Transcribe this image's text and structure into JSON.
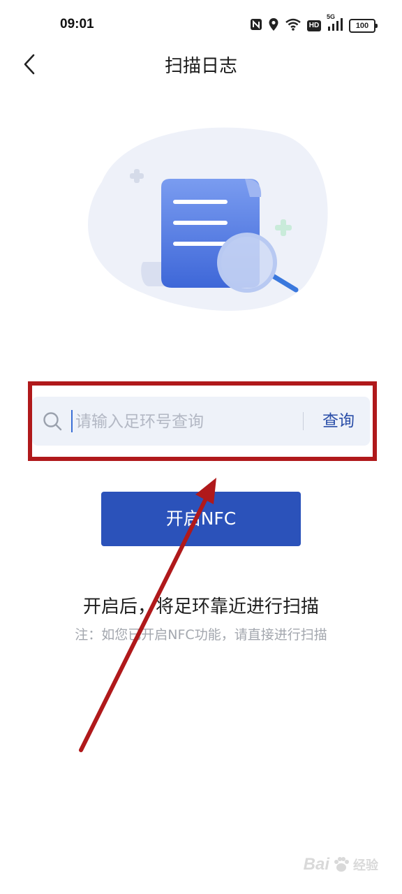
{
  "status_bar": {
    "time": "09:01",
    "battery": "100",
    "hd": "HD",
    "network": "5G",
    "icons": [
      "nfc-icon",
      "location-icon",
      "wifi-icon",
      "hd-icon",
      "signal-icon",
      "battery-icon"
    ]
  },
  "header": {
    "title": "扫描日志",
    "back_icon": "chevron-left-icon"
  },
  "search": {
    "placeholder": "请输入足环号查询",
    "value": "",
    "button_label": "查询",
    "icon": "search-icon"
  },
  "nfc": {
    "button_label": "开启NFC"
  },
  "instructions": {
    "main": "开启后，将足环靠近进行扫描",
    "note": "注：如您已开启NFC功能，请直接进行扫描"
  },
  "watermark": {
    "text": "Bai",
    "sub": "经验"
  },
  "colors": {
    "primary": "#2b52ba",
    "highlight": "#b0191b",
    "search_bg": "#eef2f9",
    "link": "#2a4ea8"
  }
}
